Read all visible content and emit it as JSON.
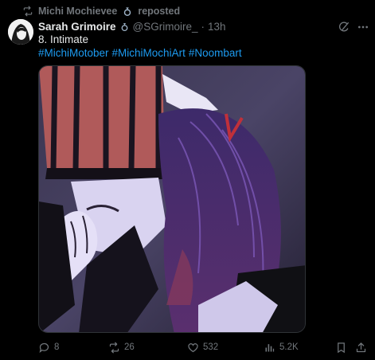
{
  "repost": {
    "reposter_name": "Michi Mochievee",
    "label": "reposted"
  },
  "tweet": {
    "author_name": "Sarah Grimoire",
    "handle": "@SGrimoire_",
    "separator": "·",
    "time": "13h",
    "text": "8. Intimate",
    "hashtags": [
      "#MichiMotober",
      "#MichiMochiArt",
      "#Noombart"
    ]
  },
  "actions": {
    "replies": "8",
    "reposts": "26",
    "likes": "532",
    "views": "5.2K"
  },
  "colors": {
    "background": "#000000",
    "text": "#e7e9ea",
    "muted": "#71767b",
    "link": "#1d9bf0"
  },
  "icons": {
    "repost_header": "repost-icon",
    "badge": "ring-badge-icon",
    "grok": "grok-icon",
    "more": "more-icon",
    "reply": "reply-icon",
    "retweet": "repost-icon",
    "like": "heart-icon",
    "views": "views-icon",
    "bookmark": "bookmark-icon",
    "share": "share-icon"
  }
}
